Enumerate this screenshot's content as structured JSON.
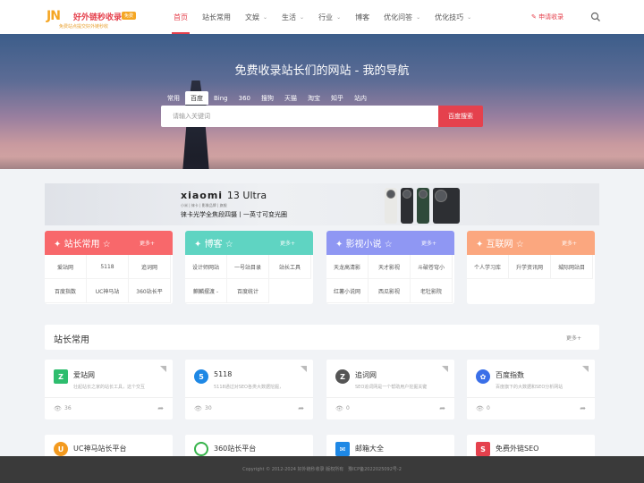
{
  "logo": {
    "mark": "JN",
    "title": "好外链秒收录",
    "tag": "免费",
    "slogan": "免费站点提交好外链秒收"
  },
  "nav": {
    "items": [
      {
        "label": "首页",
        "active": true,
        "dropdown": false
      },
      {
        "label": "站长常用",
        "active": false,
        "dropdown": false
      },
      {
        "label": "文娱",
        "active": false,
        "dropdown": true
      },
      {
        "label": "生活",
        "active": false,
        "dropdown": true
      },
      {
        "label": "行业",
        "active": false,
        "dropdown": true
      },
      {
        "label": "博客",
        "active": false,
        "dropdown": false
      },
      {
        "label": "优化问答",
        "active": false,
        "dropdown": true
      },
      {
        "label": "优化技巧",
        "active": false,
        "dropdown": true
      }
    ],
    "apply_label": "申请收录",
    "search_icon": "search-icon"
  },
  "hero": {
    "title": "免费收录站长们的网站 - 我的导航",
    "tabs": [
      "常用",
      "百度",
      "Bing",
      "360",
      "搜狗",
      "天猫",
      "淘宝",
      "知乎",
      "站内"
    ],
    "active_tab": "百度",
    "search_placeholder": "请输入关键词",
    "search_button": "百度搜索"
  },
  "ad": {
    "brand": "xiaomi",
    "model": "13 Ultra",
    "subline": "小米 | 徕卡 | 影像品牌 | 旗舰",
    "headline": "徕卡光学全焦段四摄丨一英寸可变光圈"
  },
  "categories": [
    {
      "title": "站长常用",
      "more": "更多+",
      "color": "#f8686b",
      "items": [
        "爱站网",
        "5118",
        "追词网",
        "百度指数",
        "UC神马站",
        "360站长平"
      ]
    },
    {
      "title": "博客",
      "more": "更多+",
      "color": "#5fd4c2",
      "items": [
        "设计师网站",
        "一号站目录",
        "站长工具",
        "麒麟摆渡 -",
        "百度统计"
      ]
    },
    {
      "title": "影视小说",
      "more": "更多+",
      "color": "#8f97f3",
      "items": [
        "天龙高清影",
        "天才影视",
        "斗破苍穹小",
        "红薯小说网",
        "西瓜影视",
        "老牡影院"
      ]
    },
    {
      "title": "互联网",
      "more": "更多+",
      "color": "#fba77f",
      "items": [
        "个人学习库",
        "升学资讯网",
        "城际网站目"
      ]
    }
  ],
  "section": {
    "title": "站长常用",
    "more": "更多+"
  },
  "cards": [
    {
      "name": "爱站网",
      "desc": "壮起站长之家的站长工具，这个交互",
      "views": "36",
      "icon": "aizhan-icon",
      "color": "#2ebd6e"
    },
    {
      "name": "5118",
      "desc": "5118通过对SEO各类大数据挖掘，",
      "views": "30",
      "icon": "5118-icon",
      "color": "#1e88e5"
    },
    {
      "name": "追词网",
      "desc": "SEO追词网是一个帮助用户挖掘关键",
      "views": "0",
      "icon": "zhuici-icon",
      "color": "#555555"
    },
    {
      "name": "百度指数",
      "desc": "百度旗下的大数据和SEO分析网站",
      "views": "0",
      "icon": "baidu-paw-icon",
      "color": "#3a6fe8"
    }
  ],
  "cards_row2": [
    {
      "name": "UC神马站长平台",
      "icon": "uc-squirrel-icon",
      "color": "#f39a1f"
    },
    {
      "name": "360站长平台",
      "icon": "360-icon",
      "color": "#36b34a"
    },
    {
      "name": "邮箱大全",
      "icon": "mailbox-icon",
      "color": "#1e88e5"
    },
    {
      "name": "免费外链SEO",
      "icon": "seo-s-icon",
      "color": "#e5414d"
    }
  ],
  "footer": {
    "text": "Copyright © 2012-2024 好外链秒收录 版权所有　豫ICP备2022025092号-2"
  }
}
